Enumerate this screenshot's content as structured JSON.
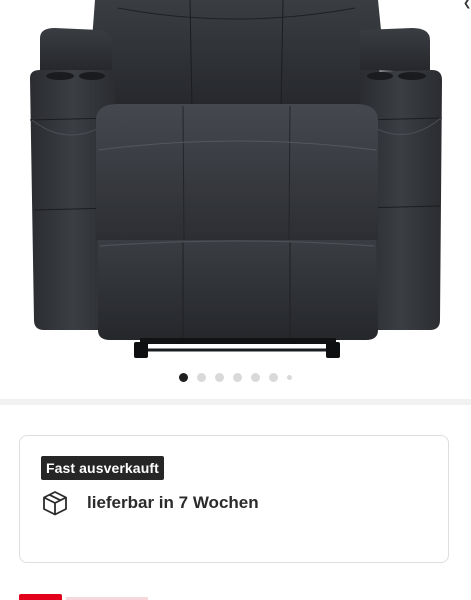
{
  "gallery": {
    "image_alt_icon": "recliner-chair-image",
    "dots_total": 7,
    "active_index": 0
  },
  "availability": {
    "badge": "Fast ausverkauft",
    "delivery_text": "lieferbar in 7 Wochen",
    "delivery_icon": "package-box-icon"
  },
  "colors": {
    "badge_bg": "#262626",
    "accent_red": "#e3001b",
    "dot_active": "#1f1f1f",
    "dot_inactive": "#d9d9d9"
  }
}
